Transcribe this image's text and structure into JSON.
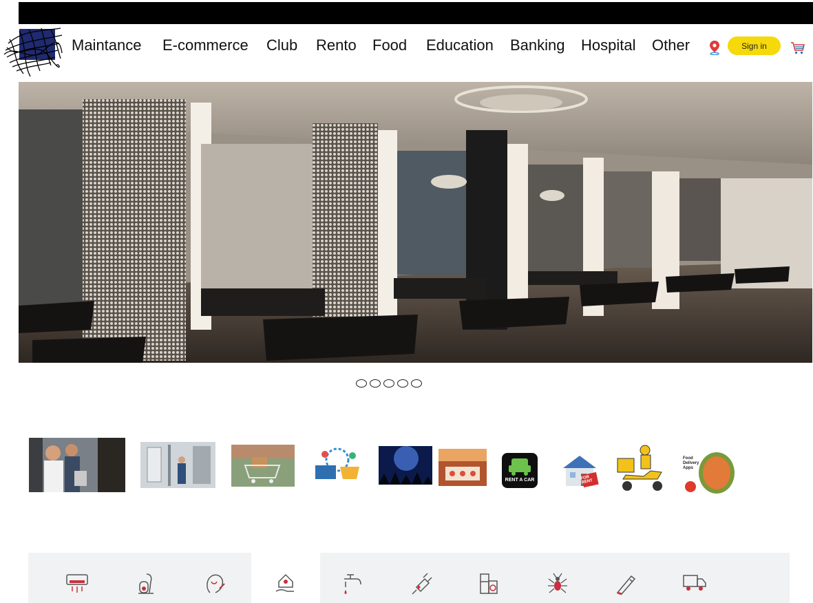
{
  "nav": {
    "items": [
      "Maintance",
      "E-commerce",
      "Club",
      "Rento",
      "Food",
      "Education",
      "Banking",
      "Hospital",
      "Other"
    ],
    "signin_label": "Sign in"
  },
  "hero": {
    "slide_count": 5,
    "active_slide": 1
  },
  "categories": [
    {
      "name": "electrical-maintenance"
    },
    {
      "name": "plumbing-maintenance"
    },
    {
      "name": "ecommerce-cart"
    },
    {
      "name": "online-shopping"
    },
    {
      "name": "club-night"
    },
    {
      "name": "event-hall"
    },
    {
      "name": "rent-a-car",
      "label": "RENT A CAR"
    },
    {
      "name": "house-for-rent",
      "label": "FOR RENT"
    },
    {
      "name": "food-delivery-scooter"
    },
    {
      "name": "food-delivery-apps",
      "label": "Food Delivery Apps"
    }
  ],
  "services": {
    "icons": [
      "ac-icon",
      "vacuum-icon",
      "beauty-icon",
      "home-care-icon",
      "plumbing-icon",
      "electric-plug-icon",
      "appliance-icon",
      "pest-icon",
      "saw-icon",
      "truck-icon"
    ],
    "active_index": 3
  },
  "colors": {
    "accent_yellow": "#f5d90a",
    "icon_red": "#c8303f",
    "bar_bg": "#f1f2f3"
  }
}
